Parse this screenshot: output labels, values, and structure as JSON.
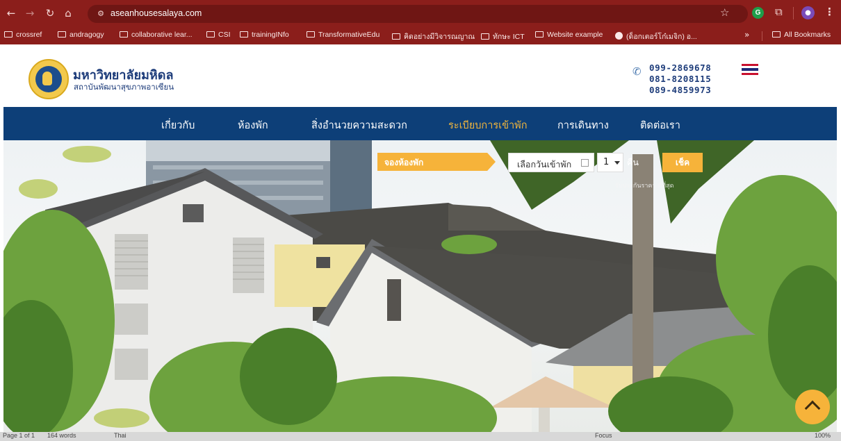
{
  "browser": {
    "url": "aseanhousesalaya.com",
    "bookmarks": [
      {
        "label": "crossref",
        "type": "folder"
      },
      {
        "label": "andragogy",
        "type": "folder"
      },
      {
        "label": "collaborative lear...",
        "type": "folder"
      },
      {
        "label": "CSI",
        "type": "folder"
      },
      {
        "label": "trainingINfo",
        "type": "folder"
      },
      {
        "label": "TransformativeEdu",
        "type": "folder"
      },
      {
        "label": "คิดอย่างมีวิจารณญาณ",
        "type": "folder"
      },
      {
        "label": "ทักษะ ICT",
        "type": "folder"
      },
      {
        "label": "Website example",
        "type": "folder"
      },
      {
        "label": "(ด็อกเตอร์โก๋เมจิก) อ...",
        "type": "site"
      }
    ],
    "bookmarks_more": "»",
    "all_bookmarks": "All Bookmarks",
    "colors": {
      "chrome": "#8b1e1b",
      "urlbar": "#6f1614"
    }
  },
  "site": {
    "brand_title": "มหาวิทยาลัยมหิดล",
    "brand_subtitle": "สถาบันพัฒนาสุขภาพอาเซียน",
    "phones": [
      "099-2869678",
      "081-8208115",
      "089-4859973"
    ],
    "language_flag": "thai-flag-icon",
    "nav": [
      {
        "label": "เกี่ยวกับ",
        "active": false
      },
      {
        "label": "ห้องพัก",
        "active": false
      },
      {
        "label": "สิ่งอำนวยความสะดวก",
        "active": false
      },
      {
        "label": "ระเบียบการเข้าพัก",
        "active": true
      },
      {
        "label": "การเดินทาง",
        "active": false
      },
      {
        "label": "ติดต่อเรา",
        "active": false
      }
    ],
    "booking": {
      "banner": "จองห้องพัก",
      "date_placeholder": "เลือกวันเข้าพัก",
      "nights_value": "1",
      "nights_label": "คืน",
      "check_button": "เช็ค",
      "best_price_note": "รับประกันราคา ดีที่สุด"
    },
    "colors": {
      "nav": "#0d3f78",
      "accent": "#f6b33a",
      "brand": "#1d3c7a"
    }
  },
  "status_bar": {
    "page": "Page 1 of 1",
    "words": "164 words",
    "lang": "Thai",
    "focus": "Focus",
    "zoom": "100%"
  }
}
